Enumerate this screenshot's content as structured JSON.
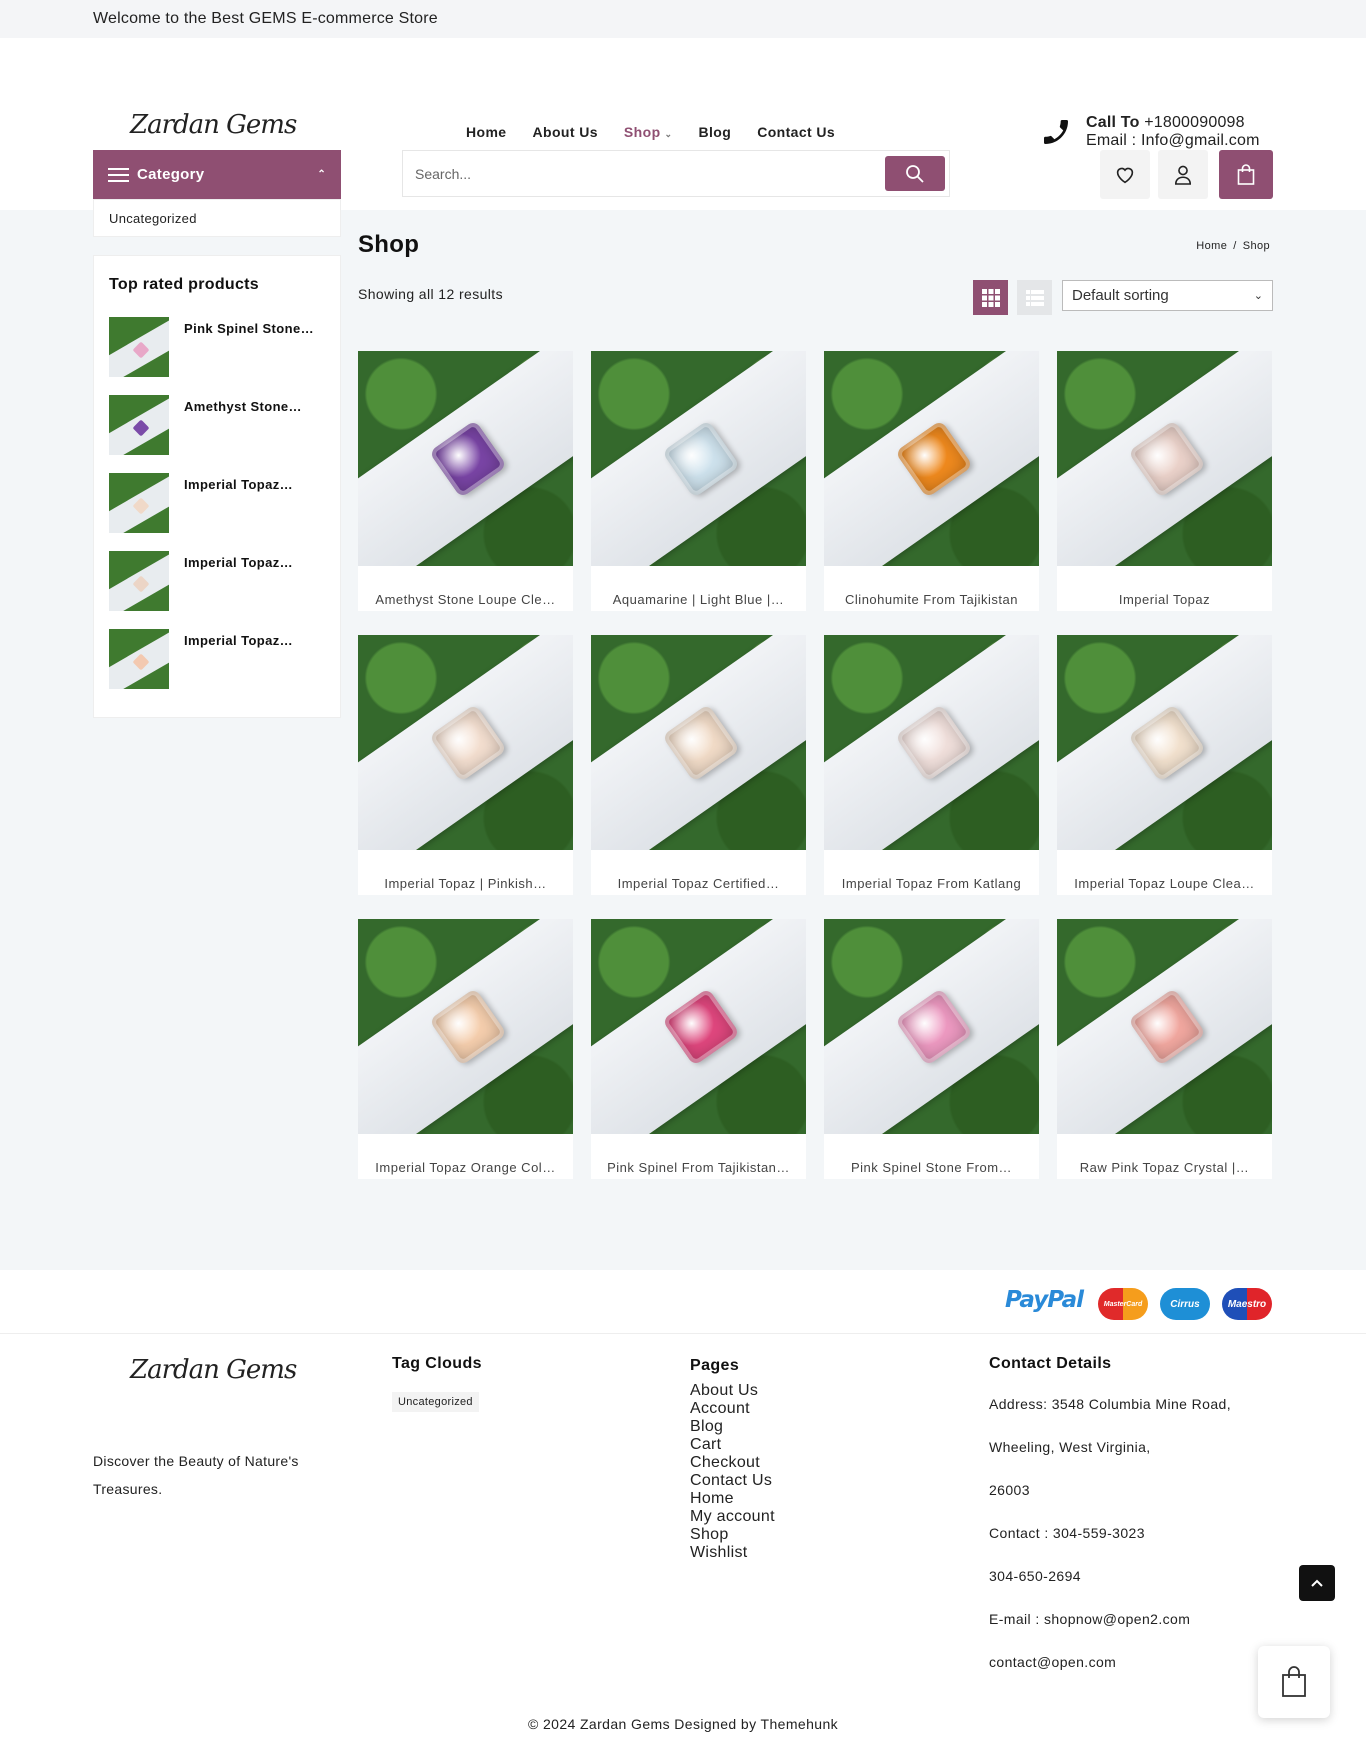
{
  "topbar": {
    "welcome": "Welcome to the Best GEMS E-commerce Store"
  },
  "header": {
    "logo": "Zardan Gems",
    "nav": [
      {
        "label": "Home"
      },
      {
        "label": "About Us"
      },
      {
        "label": "Shop",
        "active": true
      },
      {
        "label": "Blog"
      },
      {
        "label": "Contact Us"
      }
    ],
    "call": {
      "label": "Call To",
      "number": "+1800090098",
      "email_label": "Email :",
      "email": "Info@gmail.com"
    },
    "category": {
      "label": "Category",
      "items": [
        "Uncategorized"
      ]
    },
    "search": {
      "placeholder": "Search..."
    },
    "icons": [
      "heart-icon",
      "user-icon",
      "cart-icon"
    ]
  },
  "sidebar": {
    "title": "Top rated products",
    "items": [
      {
        "name": "Pink Spinel Stone…",
        "gem_color": "#e8a8c8"
      },
      {
        "name": "Amethyst Stone…",
        "gem_color": "#7b4ba8"
      },
      {
        "name": "Imperial Topaz…",
        "gem_color": "#f0d9c8"
      },
      {
        "name": "Imperial Topaz…",
        "gem_color": "#ecd5c6"
      },
      {
        "name": "Imperial Topaz…",
        "gem_color": "#f3c9b0"
      }
    ]
  },
  "shop": {
    "title": "Shop",
    "breadcrumb": [
      "Home",
      "Shop"
    ],
    "result_count": "Showing all 12 results",
    "sorting": "Default sorting",
    "products": [
      {
        "name": "Amethyst Stone Loupe Cle…",
        "gem_color": "#7a45a6"
      },
      {
        "name": "Aquamarine | Light Blue |…",
        "gem_color": "#cfe3ee"
      },
      {
        "name": "Clinohumite From Tajikistan",
        "gem_color": "#f08a1e"
      },
      {
        "name": "Imperial Topaz",
        "gem_color": "#ecd3cb"
      },
      {
        "name": "Imperial Topaz | Pinkish…",
        "gem_color": "#f4dfd0"
      },
      {
        "name": "Imperial Topaz Certified…",
        "gem_color": "#f2dcc8"
      },
      {
        "name": "Imperial Topaz From Katlang",
        "gem_color": "#f1e0dc"
      },
      {
        "name": "Imperial Topaz Loupe Clea…",
        "gem_color": "#f3e2cf"
      },
      {
        "name": "Imperial Topaz Orange Col…",
        "gem_color": "#f6cfae"
      },
      {
        "name": "Pink Spinel From Tajikistan…",
        "gem_color": "#e0477e"
      },
      {
        "name": "Pink Spinel Stone From…",
        "gem_color": "#ee9ac2"
      },
      {
        "name": "Raw Pink Topaz Crystal |…",
        "gem_color": "#f2a8a0"
      }
    ]
  },
  "payments": {
    "paypal": "PayPal",
    "mastercard": "MasterCard",
    "cirrus": "Cirrus",
    "maestro": "Maestro"
  },
  "footer": {
    "logo": "Zardan Gems",
    "description": "Discover the Beauty of Nature's Treasures.",
    "tag_title": "Tag Clouds",
    "tags": [
      "Uncategorized"
    ],
    "pages_title": "Pages",
    "pages": [
      "About Us",
      "Account",
      "Blog",
      "Cart",
      "Checkout",
      "Contact Us",
      "Home",
      "My account",
      "Shop",
      "Wishlist"
    ],
    "contact_title": "Contact Details",
    "contact": [
      "Address: 3548 Columbia Mine Road,",
      "Wheeling, West Virginia,",
      "26003",
      "Contact : 304-559-3023",
      "304-650-2694",
      "E-mail : shopnow@open2.com",
      "contact@open.com"
    ],
    "copyright": "© 2024 Zardan Gems Designed by Themehunk"
  },
  "colors": {
    "accent": "#8f4f72",
    "background": "#f3f6f8"
  }
}
